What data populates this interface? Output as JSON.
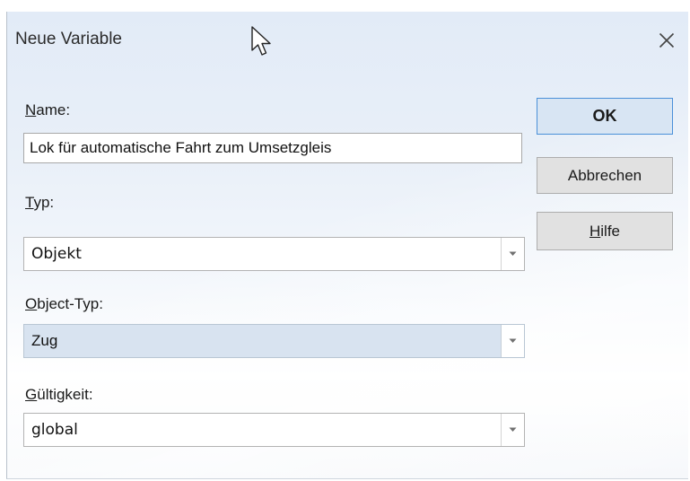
{
  "window": {
    "title": "Neue Variable",
    "close_icon": "close-icon"
  },
  "form": {
    "name_label_accel": "N",
    "name_label_rest": "ame:",
    "name_value": "Lok für automatische Fahrt zum Umsetzgleis",
    "typ_label_accel": "T",
    "typ_label_rest": "yp:",
    "typ_value": "Objekt",
    "objecttyp_label_accel": "O",
    "objecttyp_label_rest": "bject-Typ:",
    "objecttyp_value": "Zug",
    "gueltigkeit_label_accel": "G",
    "gueltigkeit_label_rest": "ültigkeit:",
    "gueltigkeit_value": "global"
  },
  "buttons": {
    "ok": "OK",
    "cancel": "Abbrechen",
    "help_accel": "H",
    "help_rest": "ilfe"
  },
  "colors": {
    "default_button_border": "#4a90d9",
    "selected_combo_bg": "#d8e3f0"
  }
}
